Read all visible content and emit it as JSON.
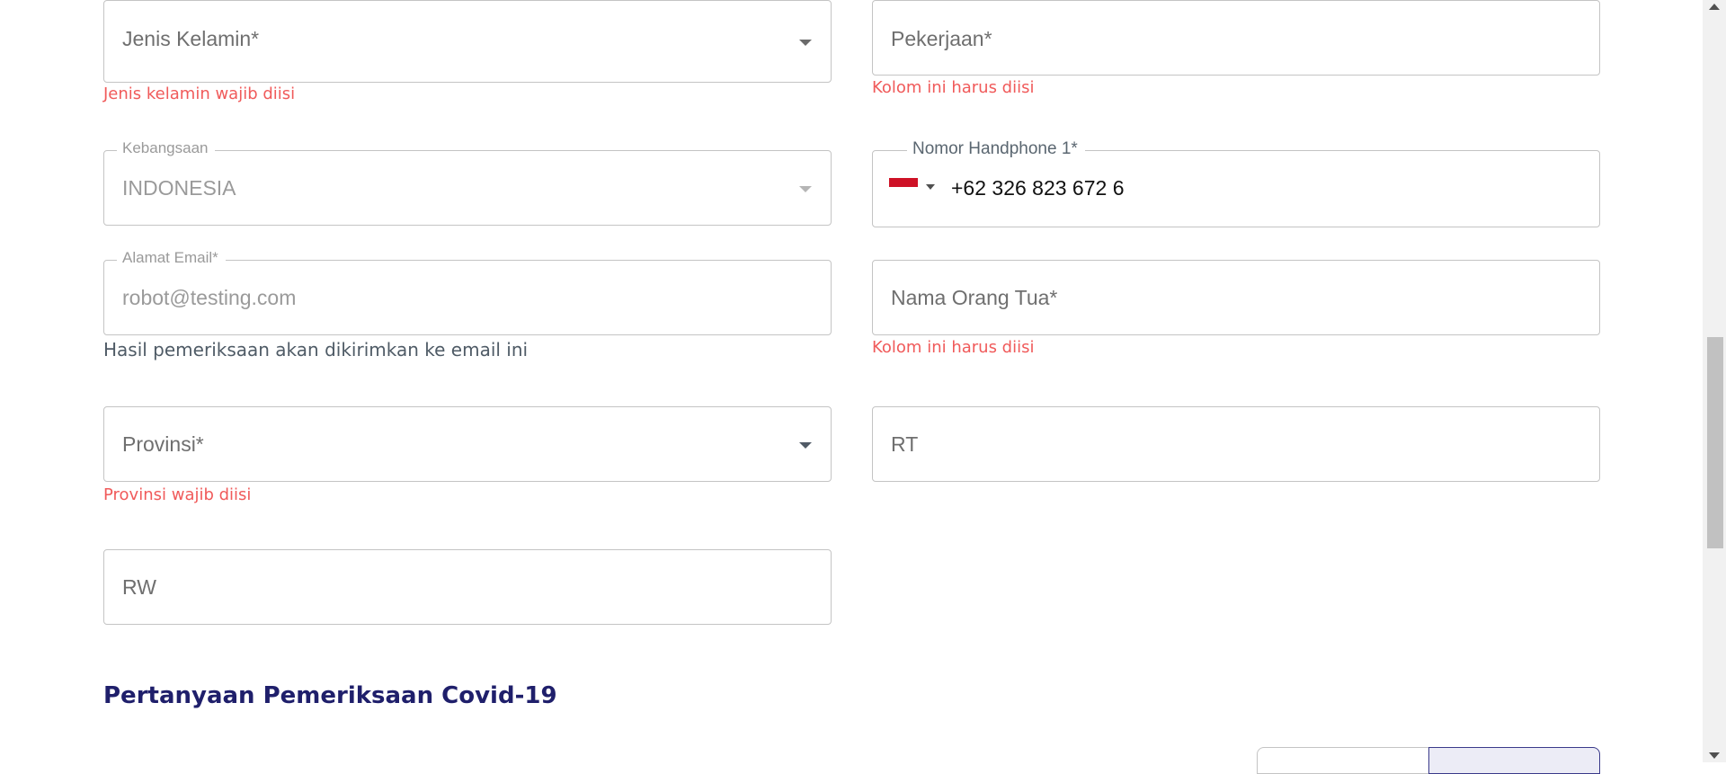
{
  "form": {
    "gender": {
      "placeholder": "Jenis Kelamin*",
      "error": "Jenis kelamin wajib diisi"
    },
    "occupation": {
      "placeholder": "Pekerjaan*",
      "error": "Kolom ini harus diisi"
    },
    "nationality": {
      "label": "Kebangsaan",
      "value": "INDONESIA"
    },
    "phone": {
      "label": "Nomor Handphone 1*",
      "value": "+62 326 823 672 6"
    },
    "email": {
      "label": "Alamat Email*",
      "value": "robot@testing.com",
      "help": "Hasil pemeriksaan akan dikirimkan ke email ini"
    },
    "parent_name": {
      "placeholder": "Nama Orang Tua*",
      "error": "Kolom ini harus diisi"
    },
    "province": {
      "placeholder": "Provinsi*",
      "error": "Provinsi wajib diisi"
    },
    "rt": {
      "placeholder": "RT"
    },
    "rw": {
      "placeholder": "RW"
    }
  },
  "section": {
    "title": "Pertanyaan Pemeriksaan Covid-19"
  },
  "colors": {
    "error": "#f05a5a",
    "section_title": "#1f1f6b",
    "flag_red": "#ce1126"
  }
}
